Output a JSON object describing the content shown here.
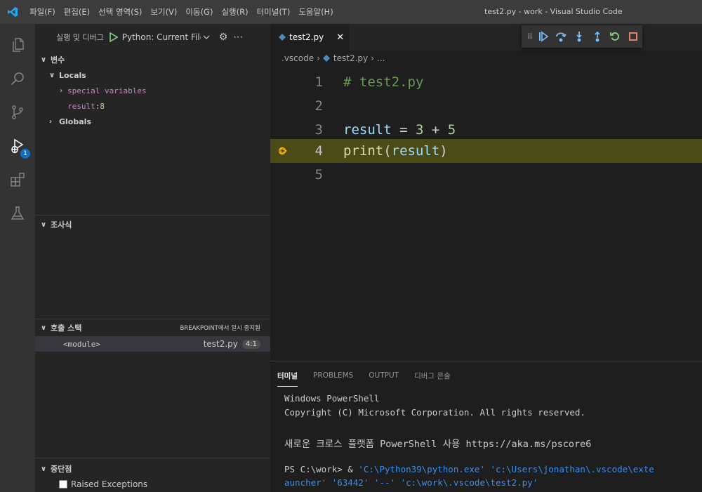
{
  "title_bar": {
    "menus": [
      "파일(F)",
      "편집(E)",
      "선택 영역(S)",
      "보기(V)",
      "이동(G)",
      "실행(R)",
      "터미널(T)",
      "도움말(H)"
    ],
    "window_title": "test2.py - work - Visual Studio Code"
  },
  "activity_bar": {
    "icons": [
      "explorer-icon",
      "search-icon",
      "source-control-icon",
      "run-debug-icon",
      "extensions-icon",
      "testing-icon"
    ],
    "debug_badge": "1"
  },
  "sidebar": {
    "run_title": "실행 및 디버그",
    "config_name": "Python: Current File",
    "variables": {
      "header": "변수",
      "locals_label": "Locals",
      "special_variables": "special variables",
      "result_name": "result",
      "result_value": "8",
      "globals_label": "Globals"
    },
    "watch": {
      "header": "조사식"
    },
    "call_stack": {
      "header": "호출 스택",
      "status": "BREAKPOINT에서 일시 중지됨",
      "frame_name": "<module>",
      "frame_file": "test2.py",
      "frame_line": "4:1"
    },
    "breakpoints": {
      "header": "중단점",
      "raised_exceptions": "Raised Exceptions"
    }
  },
  "editor": {
    "tab_label": "test2.py",
    "breadcrumb": [
      ".vscode",
      "test2.py",
      "..."
    ],
    "lines": [
      {
        "num": "1",
        "comment": "# test2.py"
      },
      {
        "num": "2"
      },
      {
        "num": "3",
        "var": "result",
        "op1": " = ",
        "n1": "3",
        "op2": " + ",
        "n2": "5"
      },
      {
        "num": "4",
        "func": "print",
        "open": "(",
        "arg": "result",
        "close": ")"
      },
      {
        "num": "5"
      }
    ]
  },
  "panel": {
    "tabs": [
      "터미널",
      "PROBLEMS",
      "OUTPUT",
      "디버그 콘솔"
    ],
    "terminal": {
      "line1": "Windows PowerShell",
      "line2": "Copyright (C) Microsoft Corporation. All rights reserved.",
      "line3": "새로운 크로스 플랫폼 PowerShell 사용 https://aka.ms/pscore6",
      "prompt": "PS C:\\work>  & ",
      "cmd1": "'C:\\Python39\\python.exe' 'c:\\Users\\jonathan\\.vscode\\exte",
      "cmd2": "auncher' '63442' '--' 'c:\\work\\.vscode\\test2.py'"
    }
  },
  "colors": {
    "accent": "#0e70c0",
    "current_line": "#4b4b18",
    "breakpoint_arrow": "#f4b400"
  }
}
